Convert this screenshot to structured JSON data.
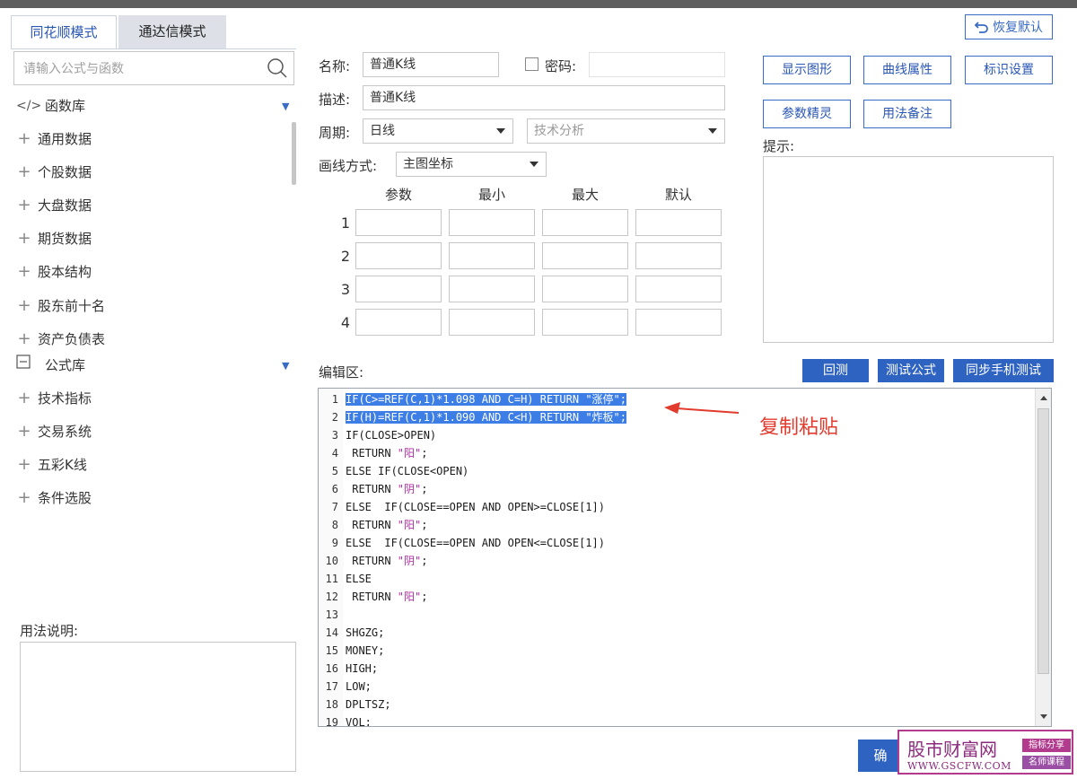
{
  "tabs": [
    {
      "label": "同花顺模式",
      "active": true
    },
    {
      "label": "通达信模式",
      "active": false
    }
  ],
  "header": {
    "restore_default": "恢复默认"
  },
  "search": {
    "placeholder": "请输入公式与函数"
  },
  "library": {
    "function_lib": "函数库",
    "function_items": [
      "通用数据",
      "个股数据",
      "大盘数据",
      "期货数据",
      "股本结构",
      "股东前十名",
      "资产负债表"
    ],
    "formula_lib": "公式库",
    "formula_items": [
      "技术指标",
      "交易系统",
      "五彩K线",
      "条件选股"
    ]
  },
  "usage": {
    "label": "用法说明:"
  },
  "form": {
    "name_label": "名称:",
    "name_value": "普通K线",
    "password_label": "密码:",
    "desc_label": "描述:",
    "desc_value": "普通K线",
    "period_label": "周期:",
    "period_value": "日线",
    "category_value": "技术分析",
    "draw_label": "画线方式:",
    "draw_value": "主图坐标"
  },
  "params": {
    "headers": [
      "参数",
      "最小",
      "最大",
      "默认"
    ],
    "rows": [
      "1",
      "2",
      "3",
      "4"
    ]
  },
  "buttons": {
    "show_graph": "显示图形",
    "curve_props": "曲线属性",
    "mark_settings": "标识设置",
    "param_wizard": "参数精灵",
    "usage_notes": "用法备注",
    "backtest": "回测",
    "test_formula": "测试公式",
    "sync_mobile": "同步手机测试",
    "ok": "确"
  },
  "hint": {
    "label": "提示:"
  },
  "editor": {
    "label": "编辑区:",
    "lines": [
      {
        "n": "1",
        "text": "IF(C>=REF(C,1)*1.098 AND C=H) RETURN \"涨停\";",
        "selected": true
      },
      {
        "n": "2",
        "text": "IF(H)=REF(C,1)*1.090 AND C<H) RETURN \"炸板\";",
        "selected": true
      },
      {
        "n": "3",
        "text": "IF(CLOSE>OPEN)",
        "selected": false
      },
      {
        "n": "4",
        "text": " RETURN \"阳\";",
        "selected": false
      },
      {
        "n": "5",
        "text": "ELSE IF(CLOSE<OPEN)",
        "selected": false
      },
      {
        "n": "6",
        "text": " RETURN \"阴\";",
        "selected": false
      },
      {
        "n": "7",
        "text": "ELSE  IF(CLOSE==OPEN AND OPEN>=CLOSE[1])",
        "selected": false
      },
      {
        "n": "8",
        "text": " RETURN \"阳\";",
        "selected": false
      },
      {
        "n": "9",
        "text": "ELSE  IF(CLOSE==OPEN AND OPEN<=CLOSE[1])",
        "selected": false
      },
      {
        "n": "10",
        "text": " RETURN \"阴\";",
        "selected": false
      },
      {
        "n": "11",
        "text": "ELSE",
        "selected": false
      },
      {
        "n": "12",
        "text": " RETURN \"阳\";",
        "selected": false
      },
      {
        "n": "13",
        "text": "",
        "selected": false
      },
      {
        "n": "14",
        "text": "SHGZG;",
        "selected": false
      },
      {
        "n": "15",
        "text": "MONEY;",
        "selected": false
      },
      {
        "n": "16",
        "text": "HIGH;",
        "selected": false
      },
      {
        "n": "17",
        "text": "LOW;",
        "selected": false
      },
      {
        "n": "18",
        "text": "DPLTSZ;",
        "selected": false
      },
      {
        "n": "19",
        "text": "VOL;",
        "selected": false
      }
    ]
  },
  "annotation": {
    "text": "复制粘贴",
    "color": "#e23b2e"
  },
  "watermark": {
    "name": "股市财富网",
    "url": "WWW.GSCFW.COM",
    "tag1": "指标分享",
    "tag2": "名师课程"
  },
  "colors": {
    "accent": "#2f63c2",
    "selection": "#3d7ee6",
    "string": "#b52da6"
  }
}
